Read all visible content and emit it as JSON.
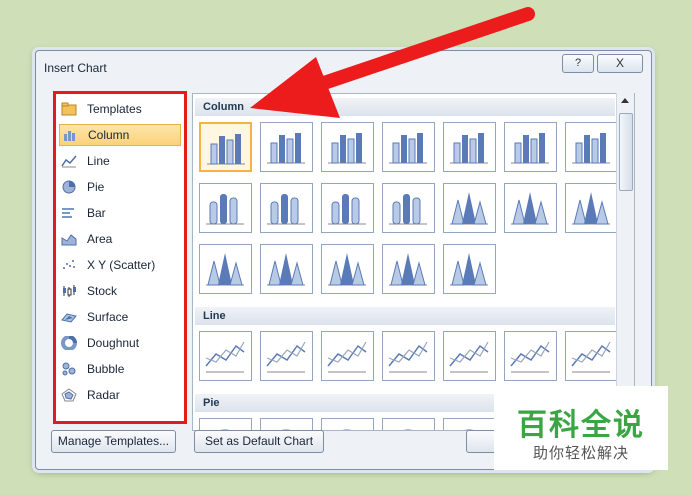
{
  "dialog": {
    "title": "Insert Chart",
    "help": "?",
    "close": "X"
  },
  "sidebar": {
    "selected_index": 1,
    "items": [
      {
        "label": "Templates",
        "icon": "folder-icon"
      },
      {
        "label": "Column",
        "icon": "column-chart-icon"
      },
      {
        "label": "Line",
        "icon": "line-chart-icon"
      },
      {
        "label": "Pie",
        "icon": "pie-chart-icon"
      },
      {
        "label": "Bar",
        "icon": "bar-chart-icon"
      },
      {
        "label": "Area",
        "icon": "area-chart-icon"
      },
      {
        "label": "X Y (Scatter)",
        "icon": "scatter-chart-icon"
      },
      {
        "label": "Stock",
        "icon": "stock-chart-icon"
      },
      {
        "label": "Surface",
        "icon": "surface-chart-icon"
      },
      {
        "label": "Doughnut",
        "icon": "doughnut-chart-icon"
      },
      {
        "label": "Bubble",
        "icon": "bubble-chart-icon"
      },
      {
        "label": "Radar",
        "icon": "radar-chart-icon"
      }
    ]
  },
  "gallery": {
    "sections": [
      {
        "label": "Column",
        "count": 19,
        "kind": "column"
      },
      {
        "label": "Line",
        "count": 7,
        "kind": "line"
      },
      {
        "label": "Pie",
        "count": 6,
        "kind": "pie"
      }
    ],
    "selected": "column-0"
  },
  "buttons": {
    "manage": "Manage Templates...",
    "default": "Set as Default Chart"
  },
  "watermark": {
    "main": "百科全说",
    "sub": "助你轻松解决"
  },
  "colors": {
    "highlight": "#e31b1b",
    "selection": "#fbd27a",
    "chart_blue": "#4f6fa8",
    "watermark_green": "#3aa643"
  }
}
